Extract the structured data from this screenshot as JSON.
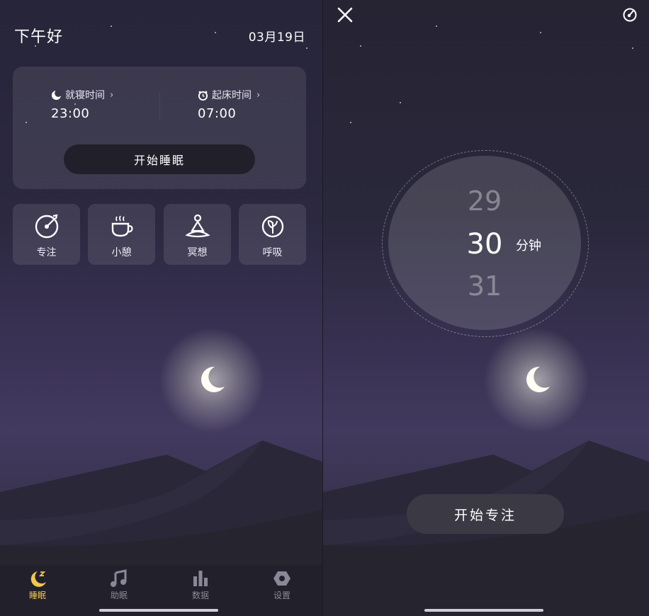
{
  "left": {
    "greeting": "下午好",
    "date": "03月19日",
    "bedtime": {
      "label": "就寝时间",
      "value": "23:00",
      "icon": "moon-icon"
    },
    "waketime": {
      "label": "起床时间",
      "value": "07:00",
      "icon": "alarm-clock-icon"
    },
    "start_sleep_label": "开始睡眠",
    "tiles": [
      {
        "label": "专注",
        "icon": "focus-target-icon"
      },
      {
        "label": "小憩",
        "icon": "coffee-cup-icon"
      },
      {
        "label": "冥想",
        "icon": "meditation-icon"
      },
      {
        "label": "呼吸",
        "icon": "leaf-icon"
      }
    ],
    "tabs": [
      {
        "label": "睡眠",
        "icon": "sleep-moon-icon",
        "active": true
      },
      {
        "label": "助眠",
        "icon": "music-note-icon",
        "active": false
      },
      {
        "label": "数据",
        "icon": "bar-chart-icon",
        "active": false
      },
      {
        "label": "设置",
        "icon": "settings-hex-icon",
        "active": false
      }
    ],
    "active_color": "#f3c64d"
  },
  "right": {
    "picker": {
      "prev": "29",
      "current": "30",
      "next": "31",
      "unit": "分钟"
    },
    "start_focus_label": "开始专注"
  }
}
